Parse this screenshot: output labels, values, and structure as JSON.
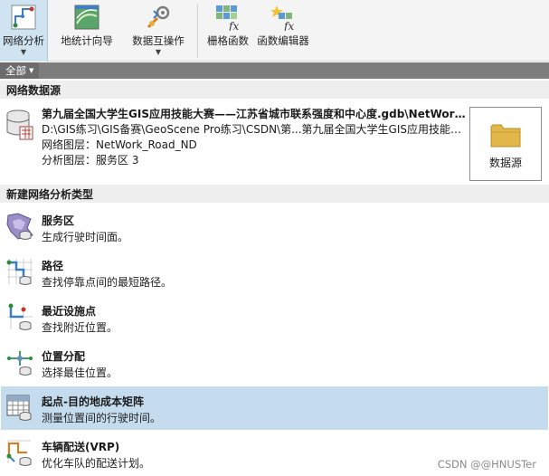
{
  "ribbon": {
    "buttons": [
      {
        "label": "网络分析",
        "icon": "network-analysis-icon",
        "dropdown": true,
        "active": true
      },
      {
        "label": "地统计向导",
        "icon": "geostatistical-wizard-icon",
        "dropdown": false
      },
      {
        "label": "数据互操作",
        "icon": "data-interop-icon",
        "dropdown": true
      },
      {
        "label": "栅格函数",
        "icon": "raster-functions-icon",
        "dropdown": false
      },
      {
        "label": "函数编辑器",
        "icon": "function-editor-icon",
        "dropdown": false
      }
    ]
  },
  "category": {
    "label": "全部"
  },
  "network_source": {
    "header": "网络数据源",
    "gdb_path": "第九届全国大学生GIS应用技能大赛——江苏省城市联系强度和中心度.gdb\\NetWork...",
    "full_path": "D:\\GIS练习\\GIS备赛\\GeoScene Pro练习\\CSDN\\第...第九届全国大学生GIS应用技能大...",
    "layer_line": "网络图层：NetWork_Road_ND",
    "analysis_layer_line": "分析图层：服务区 3",
    "button_label": "数据源"
  },
  "analysis_types": {
    "header": "新建网络分析类型",
    "items": [
      {
        "title": "服务区",
        "desc": "生成行驶时间面。",
        "icon": "service-area-icon"
      },
      {
        "title": "路径",
        "desc": "查找停靠点间的最短路径。",
        "icon": "route-icon"
      },
      {
        "title": "最近设施点",
        "desc": "查找附近位置。",
        "icon": "closest-facility-icon"
      },
      {
        "title": "位置分配",
        "desc": "选择最佳位置。",
        "icon": "location-allocation-icon"
      },
      {
        "title": "起点-目的地成本矩阵",
        "desc": "测量位置间的行驶时间。",
        "icon": "od-cost-matrix-icon",
        "selected": true
      },
      {
        "title": "车辆配送(VRP)",
        "desc": "优化车队的配送计划。",
        "icon": "vehicle-routing-icon"
      }
    ]
  },
  "colors": {
    "selected_row": "#c5dcee",
    "active_tab": "#cfe3f1",
    "category_bar": "#7d7d7d",
    "folder": "#e2b74a"
  },
  "watermark": "CSDN @@HNUSTer"
}
